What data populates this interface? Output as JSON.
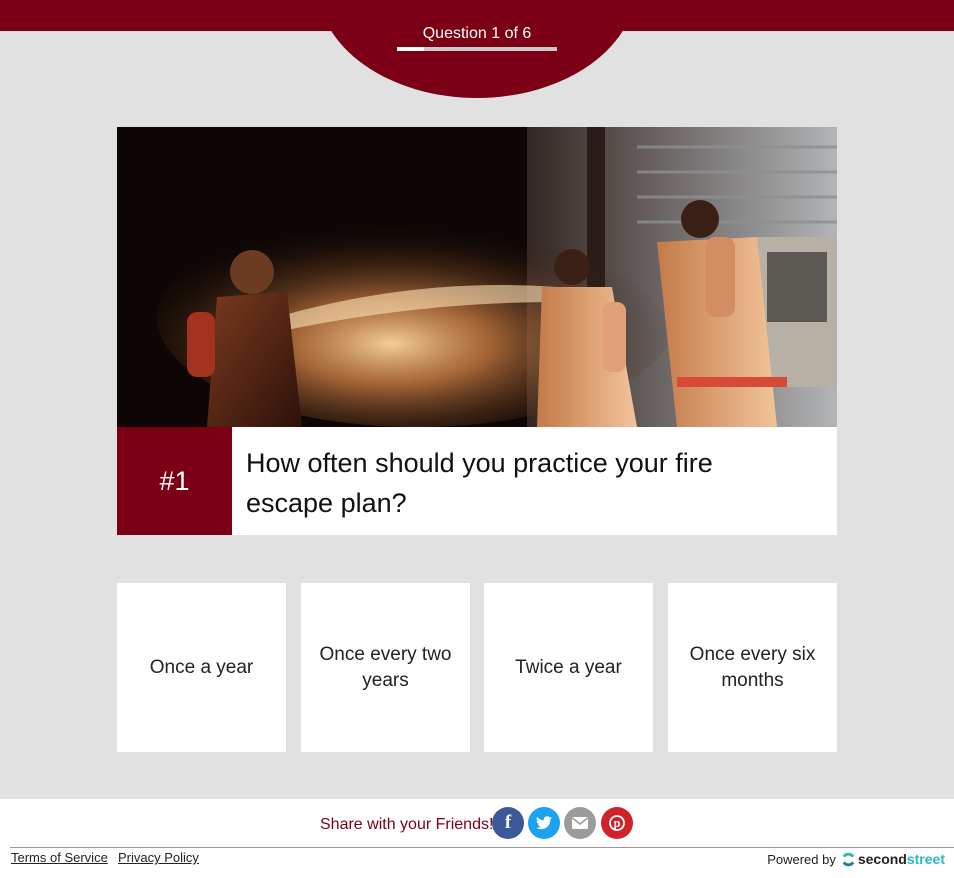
{
  "header": {
    "progress_label": "Question 1 of 6",
    "progress_fraction": 0.1667,
    "accent_color": "#7b0016"
  },
  "question": {
    "number": "#1",
    "text": "How often should you practice your fire escape plan?",
    "image_icon": "firefighters-photo"
  },
  "answers": [
    "Once a year",
    "Once every two years",
    "Twice a year",
    "Once every six months"
  ],
  "share": {
    "label": "Share with your Friends!",
    "buttons": [
      {
        "icon": "facebook-icon",
        "color": "#3b5998"
      },
      {
        "icon": "twitter-icon",
        "color": "#1da1f2"
      },
      {
        "icon": "email-icon",
        "color": "#9b9b9b"
      },
      {
        "icon": "pinterest-icon",
        "color": "#d0222a"
      }
    ]
  },
  "footer": {
    "terms": "Terms of Service",
    "privacy": "Privacy Policy",
    "powered_by": "Powered by",
    "brand_part1": "second",
    "brand_part2": "street"
  }
}
